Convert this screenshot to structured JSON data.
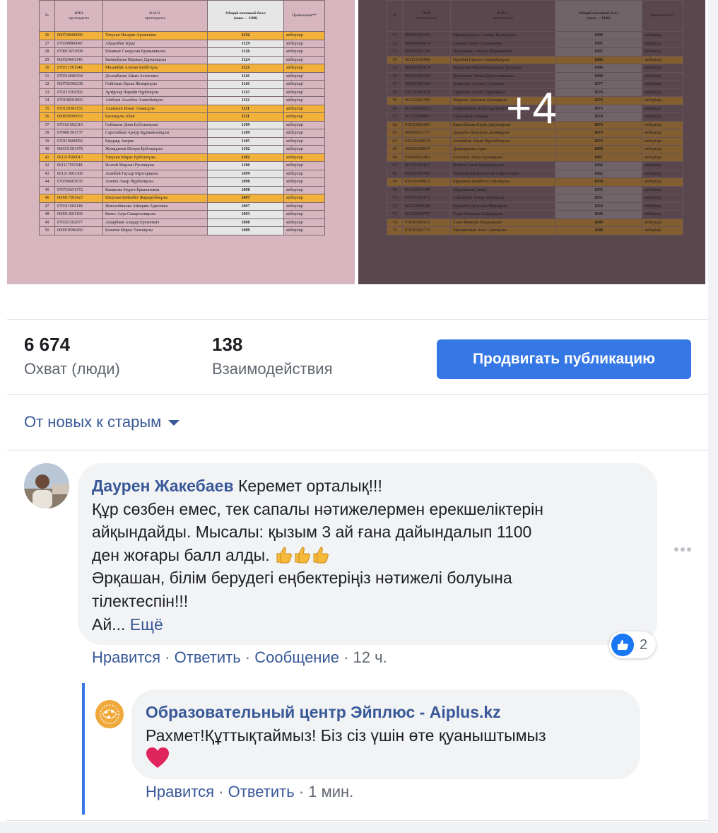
{
  "photos": {
    "more_count": "+4",
    "left_header": [
      "№",
      "ИИН\nпретендента",
      "Ф.И.О.\nпретендента",
      "Общий итоговый балл\n(макс. – 1300)",
      "Примечание**"
    ],
    "left_rows": [
      {
        "n": "26",
        "iin": "060720600986",
        "name": "Тлеухан Назерке Арлановна",
        "score": "1132",
        "note": "жіберілді",
        "hl": true
      },
      {
        "n": "27",
        "iin": "070300000047",
        "name": "Айдынбек Зерде",
        "score": "1129",
        "note": "жіберілді",
        "hl": false
      },
      {
        "n": "28",
        "iin": "070815653698",
        "name": "Шамшат Сандугаш Куанышкызы",
        "score": "1126",
        "note": "жіберілді",
        "hl": false
      },
      {
        "n": "29",
        "iin": "060524601146",
        "name": "Кенжебаева Маржан Дарханкызы",
        "score": "1124",
        "note": "жіберілді",
        "hl": false
      },
      {
        "n": "30",
        "iin": "070711501148",
        "name": "Мизанбай Алихан Бейбітұлы",
        "score": "1121",
        "note": "жіберілді",
        "hl": true
      },
      {
        "n": "31",
        "iin": "070516600394",
        "name": "Досембаева Айым Асхатовна",
        "score": "1116",
        "note": "жіберілді",
        "hl": false
      },
      {
        "n": "32",
        "iin": "060702500238",
        "name": "Сейітжан Ерали Жомартұлы",
        "score": "1116",
        "note": "жіберілді",
        "hl": false
      },
      {
        "n": "33",
        "iin": "070115502502",
        "name": "Зұлфухар Фараби Нұрбекұлы",
        "score": "1115",
        "note": "жіберілді",
        "hl": false
      },
      {
        "n": "34",
        "iin": "070108501893",
        "name": "Айтбаев Асылбек Ахметбекұлы",
        "score": "1112",
        "note": "жіберілді",
        "hl": false
      },
      {
        "n": "35",
        "iin": "070120501155",
        "name": "Ашимхан Ильяс Алмасұлы",
        "score": "1111",
        "note": "жіберілді",
        "hl": true
      },
      {
        "n": "36",
        "iin": "060820500933",
        "name": "Баглаңұлы Абай",
        "score": "1111",
        "note": "жіберілді",
        "hl": true
      },
      {
        "n": "37",
        "iin": "070321602310",
        "name": "Сейтказы Дина Есболатқызы",
        "score": "1109",
        "note": "жіберілді",
        "hl": false
      },
      {
        "n": "38",
        "iin": "070401501737",
        "name": "Сарсембаев Арнур Құрманғалиұлы",
        "score": "1109",
        "note": "жіберілді",
        "hl": false
      },
      {
        "n": "39",
        "iin": "070119600950",
        "name": "Бердаққ Акерке",
        "score": "1105",
        "note": "жіберілді",
        "hl": false
      },
      {
        "n": "40",
        "iin": "060331501478",
        "name": "Жумадилов Шоқан Ерболатұлы",
        "score": "1102",
        "note": "жіберілді",
        "hl": false
      },
      {
        "n": "41",
        "iin": "061219500017",
        "name": "Тлеухан Мирас Ерболатұлы",
        "score": "1102",
        "note": "жіберілді",
        "hl": true
      },
      {
        "n": "42",
        "iin": "061117501548",
        "name": "Исатай Мирлан Русланұлы",
        "score": "1100",
        "note": "жіберілді",
        "hl": false
      },
      {
        "n": "43",
        "iin": "061213601306",
        "name": "Асанбай Гаухар Мұхтарқызы",
        "score": "1099",
        "note": "жіберілді",
        "hl": false
      },
      {
        "n": "44",
        "iin": "070506601635",
        "name": "Анниеі Ажар Нұрболқызы",
        "score": "1098",
        "note": "жіберілді",
        "hl": false
      },
      {
        "n": "45",
        "iin": "070723651572",
        "name": "Капанова Заурен Ерканатовна",
        "score": "1098",
        "note": "жіберілді",
        "hl": false
      },
      {
        "n": "46",
        "iin": "060917501423",
        "name": "Шертаев Бейімбет Жарқынбекұлы",
        "score": "1097",
        "note": "жіберілді",
        "hl": true
      },
      {
        "n": "47",
        "iin": "070311602148",
        "name": "Жексенбинова Айкерим Адиловна",
        "score": "1097",
        "note": "жіберілді",
        "hl": false
      },
      {
        "n": "48",
        "iin": "060913601169",
        "name": "Кенес Алуа Сапарғалиқызы",
        "score": "1093",
        "note": "жіберілді",
        "hl": false
      },
      {
        "n": "49",
        "iin": "070321502077",
        "name": "Асқарбаев Алидар Ертанович",
        "score": "1090",
        "note": "жіберілді",
        "hl": false
      },
      {
        "n": "50",
        "iin": "060918500450",
        "name": "Болатов Мирас Талғатұлы",
        "score": "1089",
        "note": "жіберілді",
        "hl": false
      }
    ],
    "right_rows": [
      {
        "n": "51",
        "iin": "060816601450",
        "name": "Мұхамедкәрім Сымбат Ерланқызы",
        "score": "1089",
        "note": "жіберілді",
        "hl": false
      },
      {
        "n": "52",
        "iin": "060808600074",
        "name": "Сырым Самал Сағдатқызы",
        "score": "1087",
        "note": "жіберілді",
        "hl": false
      },
      {
        "n": "53",
        "iin": "060909601336",
        "name": "Нурғожина Айсулу Миржановна",
        "score": "1087",
        "note": "жіберілді",
        "hl": false
      },
      {
        "n": "54",
        "iin": "061121500996",
        "name": "Оразбай Ерасыл Айдынбекұлы",
        "score": "1086",
        "note": "жіберілді",
        "hl": true
      },
      {
        "n": "55",
        "iin": "060629501824",
        "name": "Жұматаев Мұхаммедқайдар Дулатұлы",
        "score": "1086",
        "note": "жіберілді",
        "hl": false
      },
      {
        "n": "56",
        "iin": "060912601690",
        "name": "Даулетжан Улпан Даулетжанқызы",
        "score": "1080",
        "note": "жіберілді",
        "hl": false
      },
      {
        "n": "57",
        "iin": "060527601608",
        "name": "Ахметова Аружан Сактовна",
        "score": "1077",
        "note": "жіберілді",
        "hl": false
      },
      {
        "n": "58",
        "iin": "070720601629",
        "name": "Тұрысова Ләззат Тұрысқызы",
        "score": "1076",
        "note": "жіберілді",
        "hl": false
      },
      {
        "n": "59",
        "iin": "061212601509",
        "name": "Шералы Айганым Ерланқызы",
        "score": "1076",
        "note": "жіберілді",
        "hl": true
      },
      {
        "n": "60",
        "iin": "061116600023",
        "name": "Амиржанова Алуа Нұрланқызы",
        "score": "1075",
        "note": "жіберілді",
        "hl": false
      },
      {
        "n": "61",
        "iin": "061202600863",
        "name": "Ержанқызы Елдана",
        "score": "1074",
        "note": "жіберілді",
        "hl": false
      },
      {
        "n": "62",
        "iin": "070214601806",
        "name": "Бақытбекова Еңлік Дауренқызы",
        "score": "1073",
        "note": "жіберілді",
        "hl": true
      },
      {
        "n": "63",
        "iin": "060608551717",
        "name": "Даудабек Батырхан Даниярұлы",
        "score": "1073",
        "note": "жіберілді",
        "hl": true
      },
      {
        "n": "64",
        "iin": "070226600576",
        "name": "Алтынбай Айым Нұрсейітқызы",
        "score": "1073",
        "note": "жіберілді",
        "hl": true
      },
      {
        "n": "65",
        "iin": "060606600847",
        "name": "Даниярқызы Адия",
        "score": "1068",
        "note": "жіберілді",
        "hl": true
      },
      {
        "n": "66",
        "iin": "070418652061",
        "name": "Болатхан Айша Ерланқызы",
        "score": "1067",
        "note": "жіберілді",
        "hl": true
      },
      {
        "n": "67",
        "iin": "061207601821",
        "name": "Өтеуіл Сания Қуандыққызы",
        "score": "1066",
        "note": "жіберілді",
        "hl": false
      },
      {
        "n": "68",
        "iin": "060528501449",
        "name": "Тойшыбеков Бексултан Саресенович",
        "score": "1062",
        "note": "жіберілді",
        "hl": false
      },
      {
        "n": "69",
        "iin": "070116600012",
        "name": "Мұханова Жанбота Саматқызы",
        "score": "1059",
        "note": "жіберілді",
        "hl": true
      },
      {
        "n": "70",
        "iin": "061105601309",
        "name": "Абдукамалқ Аяпат",
        "score": "1055",
        "note": "жіберілді",
        "hl": false
      },
      {
        "n": "71",
        "iin": "070105501071",
        "name": "Сәйлаубай Асқар Ержанұлы",
        "score": "1051",
        "note": "жіберілді",
        "hl": false
      },
      {
        "n": "72",
        "iin": "061214500298",
        "name": "Курасбек Дулатхан Мерейұлы",
        "score": "1050",
        "note": "жіберілді",
        "hl": false
      },
      {
        "n": "73",
        "iin": "061129500797",
        "name": "Уали Бексеиры Хайдарұлы",
        "score": "1049",
        "note": "жіберілді",
        "hl": false
      },
      {
        "n": "74",
        "iin": "070417602431",
        "name": "Саин Жанерке Бердеңқызы",
        "score": "1049",
        "note": "жіберілді",
        "hl": true
      },
      {
        "n": "75",
        "iin": "070313601715",
        "name": "Мұхаметжан Аиза Серікқызы",
        "score": "1048",
        "note": "жіберілді",
        "hl": true
      }
    ]
  },
  "stats": {
    "reach_value": "6 674",
    "reach_label": "Охват (люди)",
    "engagement_value": "138",
    "engagement_label": "Взаимодействия"
  },
  "promote_label": "Продвигать публикацию",
  "sort_label": "От новых к старым",
  "comment": {
    "author": "Даурен Жакебаев",
    "first_line": " Керемет орталық!!!",
    "line2": "Құр сөзбен емес, тек сапалы нәтижелермен ерекшеліктерін",
    "line3": "айқындайды. Мысалы: қызым 3 ай ғана дайындалып 1100",
    "line4": "ден жоғары балл алды.",
    "line5": "Әрқашан, білім берудегі еңбектеріңіз нәтижелі болуына",
    "line6": "тілектеспін!!!",
    "line7": "Ай...",
    "more": "Ещё",
    "like_count": "2",
    "actions": {
      "like": "Нравится",
      "reply": "Ответить",
      "message": "Сообщение",
      "time": "12 ч.",
      "sep": " · "
    }
  },
  "reply": {
    "author": "Образовательный центр Эйплюс - Aiplus.kz",
    "text": "Рахмет!Құттықтаймыз! Біз сіз үшін өте қуаныштымыз",
    "actions": {
      "like": "Нравится",
      "reply": "Ответить",
      "time": "1 мин.",
      "sep": " · "
    }
  },
  "colors": {
    "link": "#385898",
    "button": "#3578e5",
    "bubble": "#f2f3f5",
    "highlight": "#f2b13a"
  }
}
